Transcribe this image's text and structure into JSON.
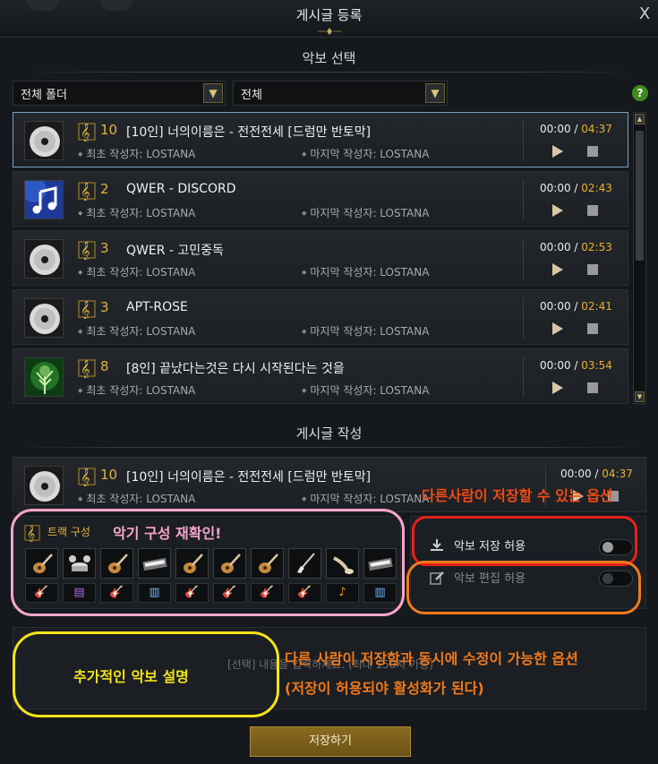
{
  "window": {
    "title": "게시글 등록",
    "close_label": "X"
  },
  "sheet_select": {
    "section_title": "악보 선택",
    "folder_dropdown": "전체 폴더",
    "filter_dropdown": "전체",
    "help_label": "?"
  },
  "songs": [
    {
      "count": "10",
      "title": "[10인] 너의이름은 - 전전전세 [드럼만 반토막]",
      "first_author": "최초 작성자: LOSTANA",
      "last_author": "마지막 작성자: LOSTANA",
      "current": "00:00",
      "sep": "/",
      "duration": "04:37",
      "thumb": "disc-icon"
    },
    {
      "count": "2",
      "title": "QWER - DISCORD",
      "first_author": "최초 작성자: LOSTANA",
      "last_author": "마지막 작성자: LOSTANA",
      "current": "00:00",
      "sep": "/",
      "duration": "02:43",
      "thumb": "music-note-icon"
    },
    {
      "count": "3",
      "title": "QWER - 고민중독",
      "first_author": "최초 작성자: LOSTANA",
      "last_author": "마지막 작성자: LOSTANA",
      "current": "00:00",
      "sep": "/",
      "duration": "02:53",
      "thumb": "disc-icon"
    },
    {
      "count": "3",
      "title": "APT-ROSE",
      "first_author": "최초 작성자: LOSTANA",
      "last_author": "마지막 작성자: LOSTANA",
      "current": "00:00",
      "sep": "/",
      "duration": "02:41",
      "thumb": "disc-icon"
    },
    {
      "count": "8",
      "title": "[8인] 끝났다는것은 다시 시작된다는 것을",
      "first_author": "최초 작성자: LOSTANA",
      "last_author": "마지막 작성자: LOSTANA",
      "current": "00:00",
      "sep": "/",
      "duration": "03:54",
      "thumb": "tree-icon"
    }
  ],
  "post": {
    "section_title": "게시글 작성",
    "selected_song": {
      "count": "10",
      "title": "[10인] 너의이름은 - 전전전세 [드럼만 반토막]",
      "first_author": "최초 작성자: LOSTANA",
      "last_author": "마지막 작성자: LOSTANA",
      "current": "00:00",
      "sep": "/",
      "duration": "04:37"
    },
    "track_title": "트랙 구성",
    "instruments": [
      "guitar",
      "drums",
      "guitar",
      "keyboard",
      "guitar",
      "guitar",
      "guitar",
      "electric-guitar",
      "horn",
      "keyboard"
    ],
    "allow_save_label": "악보 저장 허용",
    "allow_save_on": false,
    "allow_edit_label": "악보 편집 허용",
    "allow_edit_on": false,
    "description_placeholder": "[선택] 내용을 입력하세요. (최대 150자 가능)",
    "submit_label": "저장하기"
  },
  "annotations": {
    "track_note": "악기 구성 재확인!",
    "save_note": "다른사람이 저장할 수 있는 옵션",
    "edit_note_line1": "다른 사람이 저장함과 동시에 수정이 가능한 옵션",
    "edit_note_line2": "(저장이 허용되야 활성화가 된다)",
    "desc_note": "추가적인 악보 설명"
  },
  "colors": {
    "accent_gold": "#e2b43c",
    "annotation_pink": "#f6a6c8",
    "annotation_red": "#e8211b",
    "annotation_orange": "#f07a1c",
    "annotation_yellow": "#f2e31a"
  }
}
